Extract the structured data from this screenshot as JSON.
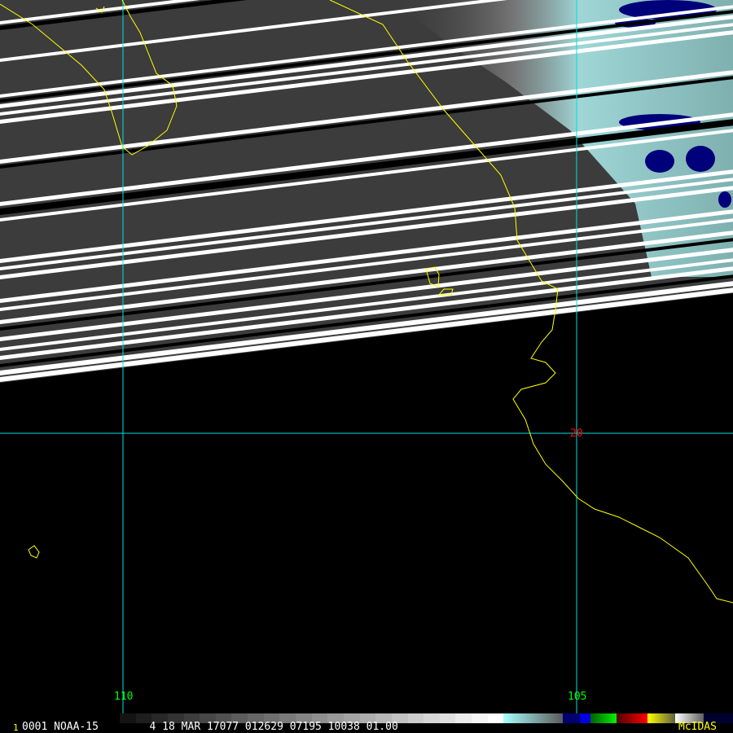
{
  "frame_number": "1",
  "info_line": "0001 NOAA-15        4 18 MAR 17077 012629 07195 10038 01.00",
  "brand": "McIDAS",
  "grid_labels": {
    "lon_110": "110",
    "lon_105": "105",
    "lat_20": "20"
  },
  "colors": {
    "coast": "#ffff00",
    "grid": "#00e0e0",
    "lon_label": "#00ff00",
    "lat_label": "#ff0000",
    "brand": "#ffff00",
    "frame": "#ffff00"
  }
}
